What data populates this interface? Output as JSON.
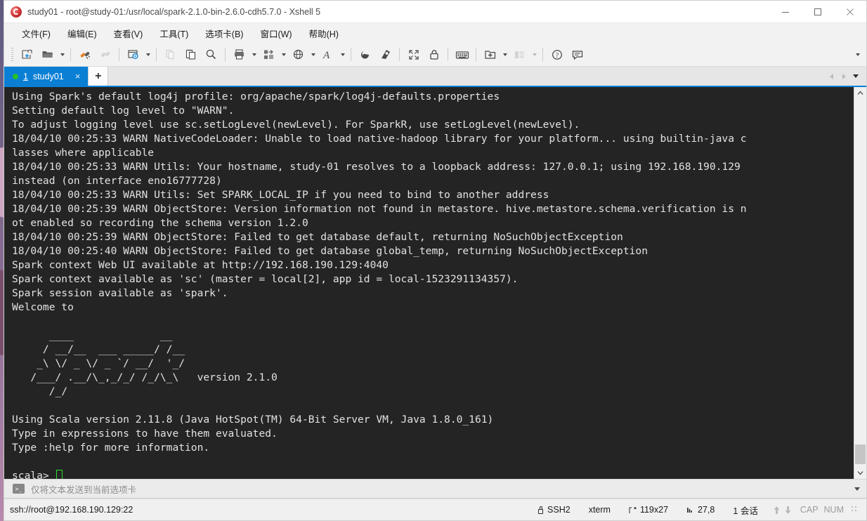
{
  "window": {
    "title": "study01 - root@study-01:/usr/local/spark-2.1.0-bin-2.6.0-cdh5.7.0 - Xshell 5",
    "app_icon": "xshell-icon",
    "minimize_label": "minimize-button",
    "maximize_label": "maximize-button",
    "close_label": "close-button"
  },
  "menubar": {
    "items": [
      {
        "label": "文件(F)",
        "name": "menu-file"
      },
      {
        "label": "编辑(E)",
        "name": "menu-edit"
      },
      {
        "label": "查看(V)",
        "name": "menu-view"
      },
      {
        "label": "工具(T)",
        "name": "menu-tools"
      },
      {
        "label": "选项卡(B)",
        "name": "menu-tabs"
      },
      {
        "label": "窗口(W)",
        "name": "menu-window"
      },
      {
        "label": "帮助(H)",
        "name": "menu-help"
      }
    ]
  },
  "toolbar": {
    "items": [
      "new-session-icon",
      "open-folder-icon",
      "connect-icon",
      "disconnect-icon",
      "session-properties-icon",
      "copy-icon",
      "paste-icon",
      "find-icon",
      "print-icon",
      "transfer-icon",
      "web-icon",
      "font-icon",
      "sftp-icon",
      "xftp-icon",
      "fullscreen-icon",
      "lock-icon",
      "keyboard-icon",
      "add-to-group-icon",
      "arrange-icon",
      "help-icon",
      "feedback-icon"
    ],
    "overflow_label": "toolbar-overflow"
  },
  "tabbar": {
    "tabs": [
      {
        "number": "1",
        "label": "study01",
        "status": "connected",
        "close": "×"
      }
    ],
    "new_tab_label": "+",
    "prev_arrow": "◀",
    "next_arrow": "▶"
  },
  "terminal": {
    "lines": [
      "Using Spark's default log4j profile: org/apache/spark/log4j-defaults.properties",
      "Setting default log level to \"WARN\".",
      "To adjust logging level use sc.setLogLevel(newLevel). For SparkR, use setLogLevel(newLevel).",
      "18/04/10 00:25:33 WARN NativeCodeLoader: Unable to load native-hadoop library for your platform... using builtin-java c",
      "lasses where applicable",
      "18/04/10 00:25:33 WARN Utils: Your hostname, study-01 resolves to a loopback address: 127.0.0.1; using 192.168.190.129",
      "instead (on interface eno16777728)",
      "18/04/10 00:25:33 WARN Utils: Set SPARK_LOCAL_IP if you need to bind to another address",
      "18/04/10 00:25:39 WARN ObjectStore: Version information not found in metastore. hive.metastore.schema.verification is n",
      "ot enabled so recording the schema version 1.2.0",
      "18/04/10 00:25:39 WARN ObjectStore: Failed to get database default, returning NoSuchObjectException",
      "18/04/10 00:25:40 WARN ObjectStore: Failed to get database global_temp, returning NoSuchObjectException",
      "Spark context Web UI available at http://192.168.190.129:4040",
      "Spark context available as 'sc' (master = local[2], app id = local-1523291134357).",
      "Spark session available as 'spark'.",
      "Welcome to",
      "",
      "      ____              __",
      "     / __/__  ___ _____/ /__",
      "    _\\ \\/ _ \\/ _ `/ __/  '_/",
      "   /___/ .__/\\_,_/_/ /_/\\_\\   version 2.1.0",
      "      /_/",
      "",
      "Using Scala version 2.11.8 (Java HotSpot(TM) 64-Bit Server VM, Java 1.8.0_161)",
      "Type in expressions to have them evaluated.",
      "Type :help for more information.",
      "",
      "scala> "
    ],
    "prompt": "scala> ",
    "cursor": "block-cursor",
    "background_color": "#242424",
    "text_color": "#e2e2e2",
    "cursor_color": "#2ee02e"
  },
  "sendbar": {
    "icon": "command-prompt-icon",
    "placeholder": "仅将文本发送到当前选项卡",
    "value": ""
  },
  "statusbar": {
    "url": "ssh://root@192.168.190.129:22",
    "protocol": "SSH2",
    "terminal_type": "xterm",
    "size": "119x27",
    "cursor_position": "27,8",
    "sessions": "1 会话",
    "caps": "CAP",
    "num": "NUM",
    "size_icon": "resize-icon",
    "pos_icon": "cursor-pos-icon",
    "up_arrow": "↑",
    "down_arrow": "↓"
  },
  "scrollbar": {
    "up": "^",
    "down": "v"
  }
}
